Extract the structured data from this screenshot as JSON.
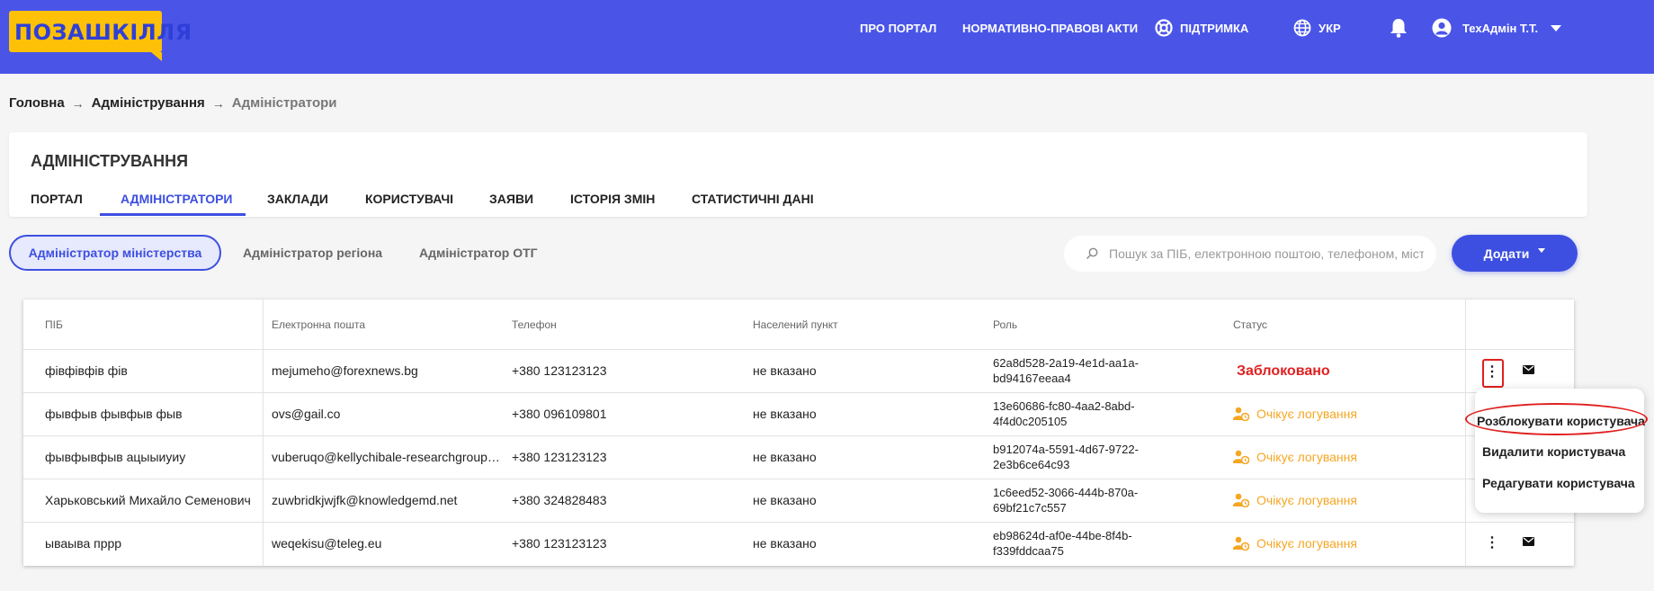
{
  "logo": {
    "text": "ПОЗАШКІЛЛЯ"
  },
  "header": {
    "nav": {
      "about": "ПРО ПОРТАЛ",
      "legal": "НОРМАТИВНО-ПРАВОВІ АКТИ",
      "support": "ПІДТРИМКА",
      "language": "УКР"
    },
    "user": "ТехАдмін Т.Т."
  },
  "breadcrumb": {
    "home": "Головна",
    "admin": "Адміністрування",
    "current": "Адміністратори"
  },
  "admin_card": {
    "title": "АДМІНІСТРУВАННЯ",
    "tabs": [
      {
        "label": "ПОРТАЛ"
      },
      {
        "label": "АДМІНІСТРАТОРИ"
      },
      {
        "label": "ЗАКЛАДИ"
      },
      {
        "label": "КОРИСТУВАЧІ"
      },
      {
        "label": "ЗАЯВИ"
      },
      {
        "label": "ІСТОРІЯ ЗМІН"
      },
      {
        "label": "СТАТИСТИЧНІ ДАНІ"
      }
    ]
  },
  "role_filters": [
    {
      "label": "Адміністратор міністерства"
    },
    {
      "label": "Адміністратор регіона"
    },
    {
      "label": "Адміністратор ОТГ"
    }
  ],
  "search": {
    "placeholder": "Пошук за ПІБ, електронною поштою, телефоном, містом"
  },
  "add_button": {
    "label": "Додати"
  },
  "table": {
    "headers": [
      "ПІБ",
      "Електронна пошта",
      "Телефон",
      "Населений пункт",
      "Роль",
      "Статус"
    ],
    "rows": [
      {
        "name": "фівфівфів фів",
        "email": "mejumeho@forexnews.bg",
        "phone": "+380 123123123",
        "city": "не вказано",
        "role": "62a8d528-2a19-4e1d-aa1a-bd94167eeaa4",
        "status": "Заблоковано"
      },
      {
        "name": "фывфыв фывфыв фыв",
        "email": "ovs@gail.co",
        "phone": "+380 096109801",
        "city": "не вказано",
        "role": "13e60686-fc80-4aa2-8abd-4f4d0c205105",
        "status": "Очікує логування"
      },
      {
        "name": "фывфывфыв ацыыиуиу",
        "email": "vuberuqo@kellychibale-researchgroup-uct.com",
        "phone": "+380 123123123",
        "city": "не вказано",
        "role": "b912074a-5591-4d67-9722-2e3b6ce64c93",
        "status": "Очікує логування"
      },
      {
        "name": "Харьковський Михайло Семенович",
        "email": "zuwbridkjwjfk@knowledgemd.net",
        "phone": "+380 324828483",
        "city": "не вказано",
        "role": "1c6eed52-3066-444b-870a-69bf21c7c557",
        "status": "Очікує логування"
      },
      {
        "name": "ываыва пррр",
        "email": "weqekisu@teleg.eu",
        "phone": "+380 123123123",
        "city": "не вказано",
        "role": "eb98624d-af0e-44be-8f4b-f339fddcaa75",
        "status": "Очікує логування"
      }
    ]
  },
  "row_menu": {
    "unblock": "Розблокувати користувача",
    "delete": "Видалити користувача",
    "edit": "Редагувати користувача"
  },
  "colors": {
    "header_bg": "#4a55e8",
    "accent": "#3d4fe0",
    "logo_bg": "#ffc107",
    "blocked": "#e02020",
    "pending": "#f5a623"
  },
  "icons": [
    "lifebuoy-icon",
    "globe-icon",
    "bell-icon",
    "account-circle-icon",
    "search-icon",
    "kebab-menu-icon",
    "mail-icon",
    "user-clock-icon"
  ]
}
